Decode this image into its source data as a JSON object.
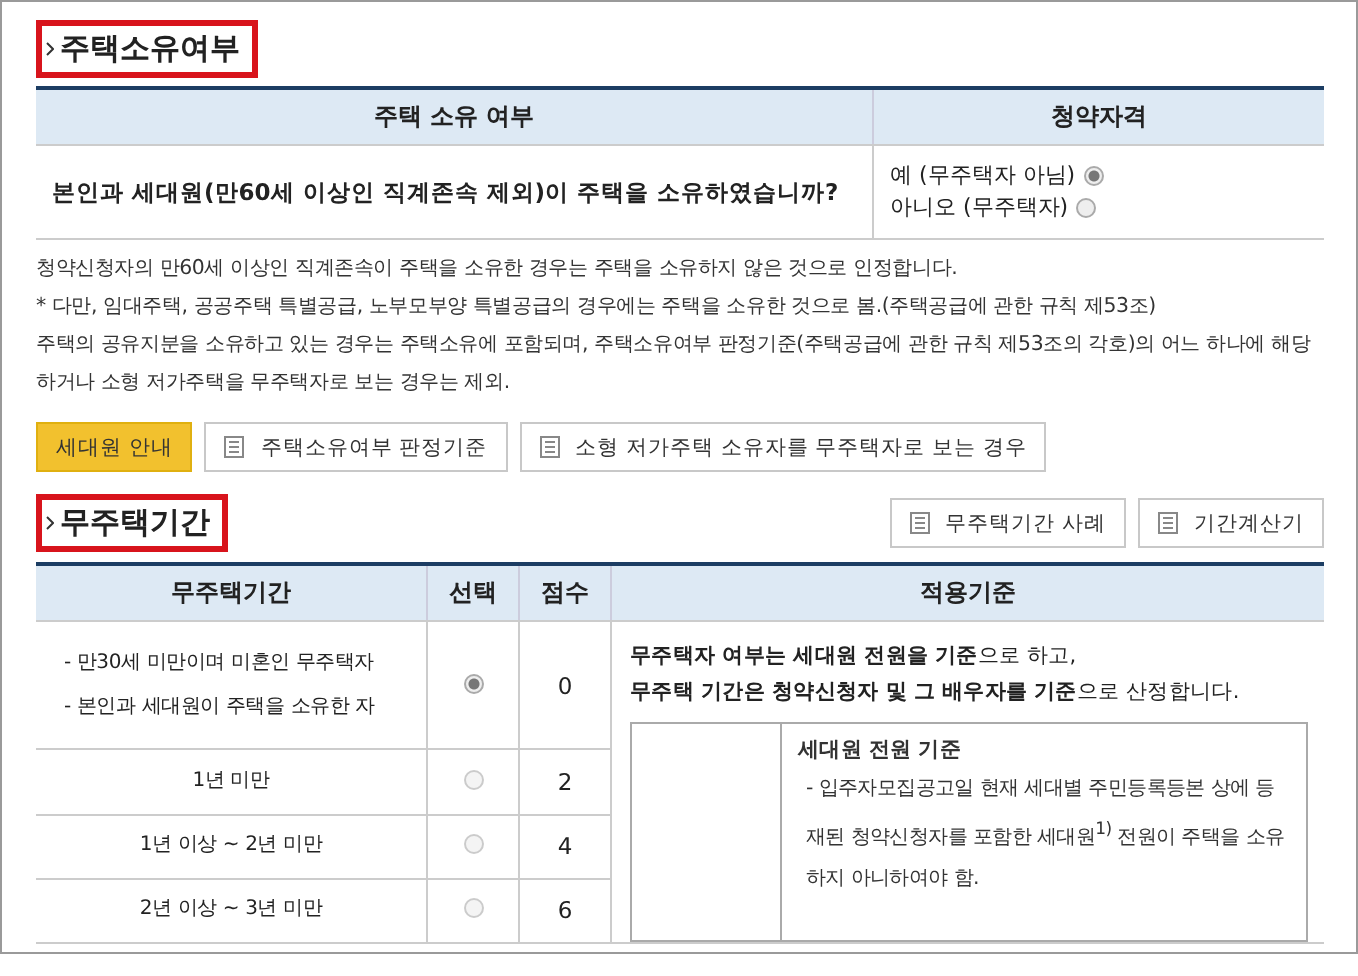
{
  "section1": {
    "title": "주택소유여부",
    "table": {
      "columns": [
        "주택 소유 여부",
        "청약자격"
      ],
      "question": "본인과 세대원(만60세 이상인 직계존속 제외)이 주택을 소유하였습니까?",
      "options": [
        {
          "label": "예 (무주택자 아님)",
          "selected": true
        },
        {
          "label": "아니오 (무주택자)",
          "selected": false
        }
      ]
    },
    "notes": [
      "청약신청자의 만60세 이상인 직계존속이 주택을 소유한 경우는 주택을 소유하지 않은 것으로 인정합니다.",
      "* 다만, 임대주택, 공공주택 특별공급, 노부모부양 특별공급의 경우에는 주택을 소유한 것으로 봄.(주택공급에 관한 규칙 제53조)",
      "주택의 공유지분을 소유하고 있는 경우는 주택소유에 포함되며, 주택소유여부 판정기준(주택공급에 관한 규칙 제53조의 각호)의 어느 하나에 해당하거나 소형 저가주택을 무주택자로 보는 경우는 제외."
    ],
    "buttons": [
      {
        "label": "세대원 안내",
        "kind": "primary"
      },
      {
        "label": "주택소유여부 판정기준",
        "kind": "doc"
      },
      {
        "label": "소형 저가주택 소유자를 무주택자로 보는 경우",
        "kind": "doc"
      }
    ]
  },
  "section2": {
    "title": "무주택기간",
    "buttons": [
      {
        "label": "무주택기간 사례",
        "kind": "doc"
      },
      {
        "label": "기간계산기",
        "kind": "doc"
      }
    ],
    "table": {
      "columns": [
        "무주택기간",
        "선택",
        "점수",
        "적용기준"
      ],
      "rows": [
        {
          "period": [
            "- 만30세 미만이며 미혼인 무주택자",
            "- 본인과 세대원이 주택을 소유한 자"
          ],
          "selected": true,
          "score": "0"
        },
        {
          "period": [
            "1년 미만"
          ],
          "selected": false,
          "score": "2"
        },
        {
          "period": [
            "1년 이상 ~ 2년 미만"
          ],
          "selected": false,
          "score": "4"
        },
        {
          "period": [
            "2년 이상 ~ 3년 미만"
          ],
          "selected": false,
          "score": "6"
        }
      ],
      "criteria": [
        "**무주택자 여부는 세대원 전원을 기준**으로 하고,",
        "**무주택 기간은 청약신청자 및 그 배우자를 기준**으로 산정합니다."
      ],
      "criteria_box": {
        "heading": "세대원 전원 기준",
        "text": "- 입주자모집공고일 현재 세대별 주민등록등본 상에 등재된 청약신청자를 포함한 세대원$^{1)}$ 전원이 주택을 소유하지 아니하여야 함."
      }
    }
  }
}
